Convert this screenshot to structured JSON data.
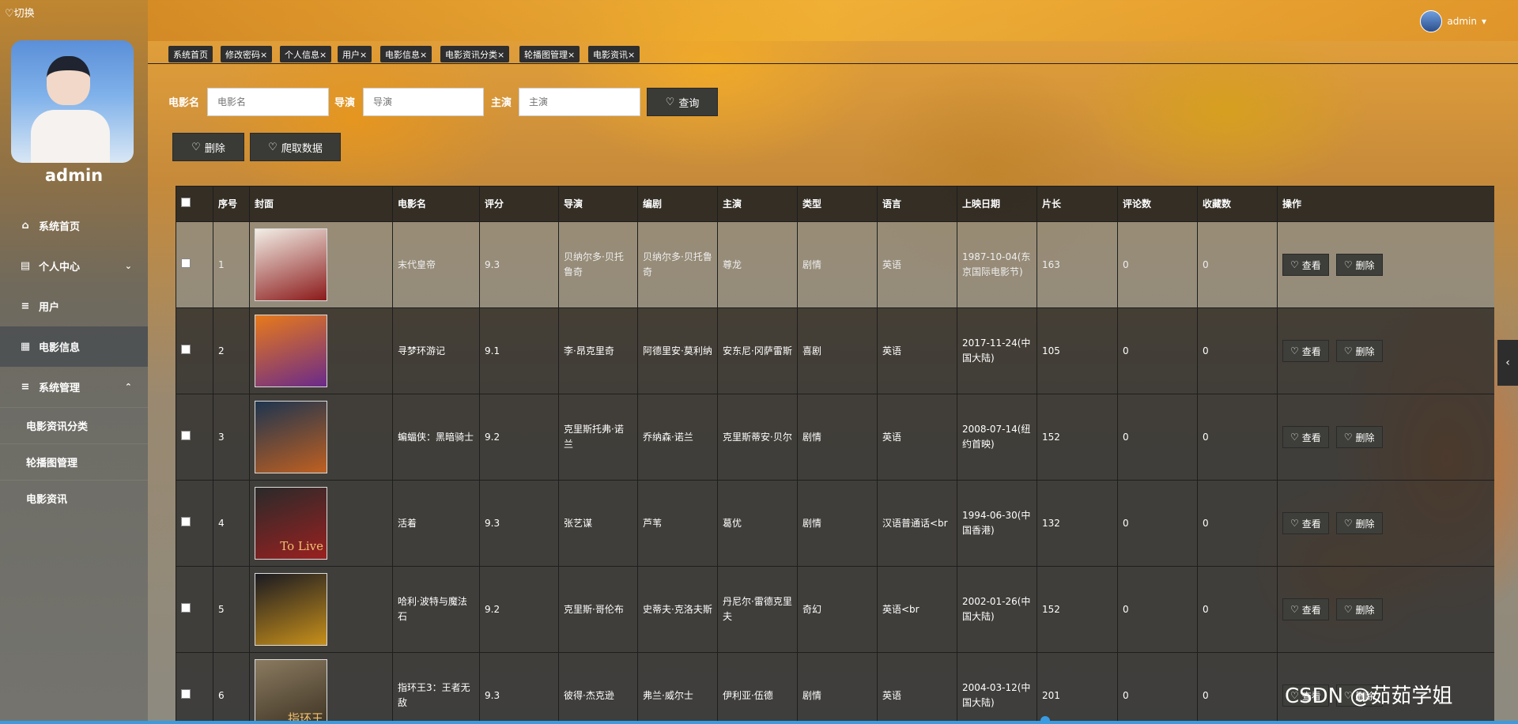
{
  "switch_label": "切换",
  "user": {
    "name": "admin",
    "header_name": "admin"
  },
  "sidebar": {
    "items": [
      {
        "label": "系统首页",
        "icon": "home-icon"
      },
      {
        "label": "个人中心",
        "icon": "calendar-icon"
      },
      {
        "label": "用户",
        "icon": "list-icon"
      },
      {
        "label": "电影信息",
        "icon": "grid-icon"
      },
      {
        "label": "系统管理",
        "icon": "list-icon"
      }
    ],
    "subitems": [
      "电影资讯分类",
      "轮播图管理",
      "电影资讯"
    ]
  },
  "tabs": [
    "系统首页",
    "修改密码×",
    "个人信息×",
    "用户×",
    "电影信息×",
    "电影资讯分类×",
    "轮播图管理×",
    "电影资讯×"
  ],
  "search": {
    "name_label": "电影名",
    "name_placeholder": "电影名",
    "director_label": "导演",
    "director_placeholder": "导演",
    "actor_label": "主演",
    "actor_placeholder": "主演",
    "query_button": "查询"
  },
  "actions": {
    "delete": "删除",
    "crawl": "爬取数据"
  },
  "table": {
    "headers": [
      "序号",
      "封面",
      "电影名",
      "评分",
      "导演",
      "编剧",
      "主演",
      "类型",
      "语言",
      "上映日期",
      "片长",
      "评论数",
      "收藏数",
      "操作"
    ],
    "view_label": "查看",
    "delete_label": "删除",
    "rows": [
      {
        "no": "1",
        "name": "末代皇帝",
        "score": "9.3",
        "director": "贝纳尔多·贝托鲁奇",
        "writer": "贝纳尔多·贝托鲁奇",
        "actor": "尊龙",
        "genre": "剧情",
        "lang": "英语",
        "date": "1987-10-04(东京国际电影节)",
        "length": "163",
        "comments": "0",
        "favs": "0",
        "poster_colors": [
          "#f2eee6",
          "#8b1a1a"
        ]
      },
      {
        "no": "2",
        "name": "寻梦环游记",
        "score": "9.1",
        "director": "李·昂克里奇",
        "writer": "阿德里安·莫利纳",
        "actor": "安东尼·冈萨雷斯",
        "genre": "喜剧",
        "lang": "英语",
        "date": "2017-11-24(中国大陆)",
        "length": "105",
        "comments": "0",
        "favs": "0",
        "poster_colors": [
          "#e87a1a",
          "#6a2a8a"
        ]
      },
      {
        "no": "3",
        "name": "蝙蝠侠：黑暗骑士",
        "score": "9.2",
        "director": "克里斯托弗·诺兰",
        "writer": "乔纳森·诺兰",
        "actor": "克里斯蒂安·贝尔",
        "genre": "剧情",
        "lang": "英语",
        "date": "2008-07-14(纽约首映)",
        "length": "152",
        "comments": "0",
        "favs": "0",
        "poster_colors": [
          "#1d3550",
          "#c06020"
        ]
      },
      {
        "no": "4",
        "name": "活着",
        "score": "9.3",
        "director": "张艺谋",
        "writer": "芦苇",
        "actor": "葛优",
        "genre": "剧情",
        "lang": "汉语普通话<br",
        "date": "1994-06-30(中国香港)",
        "length": "132",
        "comments": "0",
        "favs": "0",
        "poster_colors": [
          "#2a2a2a",
          "#9a2020"
        ],
        "poster_text": "To Live"
      },
      {
        "no": "5",
        "name": "哈利·波特与魔法石",
        "score": "9.2",
        "director": "克里斯·哥伦布",
        "writer": "史蒂夫·克洛夫斯",
        "actor": "丹尼尔·雷德克里夫",
        "genre": "奇幻",
        "lang": "英语<br",
        "date": "2002-01-26(中国大陆)",
        "length": "152",
        "comments": "0",
        "favs": "0",
        "poster_colors": [
          "#1a1a22",
          "#c8901a"
        ]
      },
      {
        "no": "6",
        "name": "指环王3：王者无敌",
        "score": "9.3",
        "director": "彼得·杰克逊",
        "writer": "弗兰·威尔士",
        "actor": "伊利亚·伍德",
        "genre": "剧情",
        "lang": "英语",
        "date": "2004-03-12(中国大陆)",
        "length": "201",
        "comments": "0",
        "favs": "0",
        "poster_colors": [
          "#8a7a60",
          "#3a3020"
        ],
        "poster_text": "指环王"
      }
    ]
  },
  "watermark": "CSDN @茹茹学姐"
}
